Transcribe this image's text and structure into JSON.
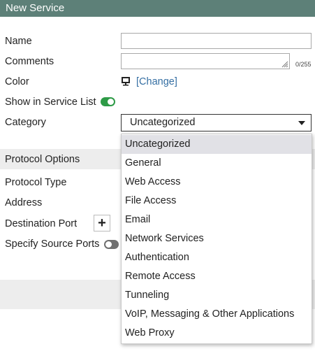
{
  "window": {
    "title": "New Service"
  },
  "form": {
    "name_label": "Name",
    "name_value": "",
    "comments_label": "Comments",
    "comments_value": "",
    "comments_count": "0/255",
    "color_label": "Color",
    "color_change": "[Change]",
    "show_label": "Show in Service List",
    "show_enabled": true,
    "category_label": "Category",
    "category_value": "Uncategorized"
  },
  "protocol": {
    "section_title": "Protocol Options",
    "type_label": "Protocol Type",
    "address_label": "Address",
    "dest_port_label": "Destination Port",
    "source_ports_label": "Specify Source Ports",
    "source_ports_enabled": false
  },
  "dropdown": {
    "selected": "Uncategorized",
    "items": [
      "Uncategorized",
      "General",
      "Web Access",
      "File Access",
      "Email",
      "Network Services",
      "Authentication",
      "Remote Access",
      "Tunneling",
      "VoIP, Messaging & Other Applications",
      "Web Proxy"
    ]
  },
  "colors": {
    "titlebar": "#5d8078",
    "toggle_on": "#2e9b47",
    "toggle_off": "#6f6f6f",
    "link": "#356fa3",
    "selected_item": "#e1e1e6"
  },
  "icons": {
    "color": "monitor-icon",
    "add": "plus-icon",
    "caret": "caret-down-icon",
    "resize": "resize-grip-icon"
  }
}
